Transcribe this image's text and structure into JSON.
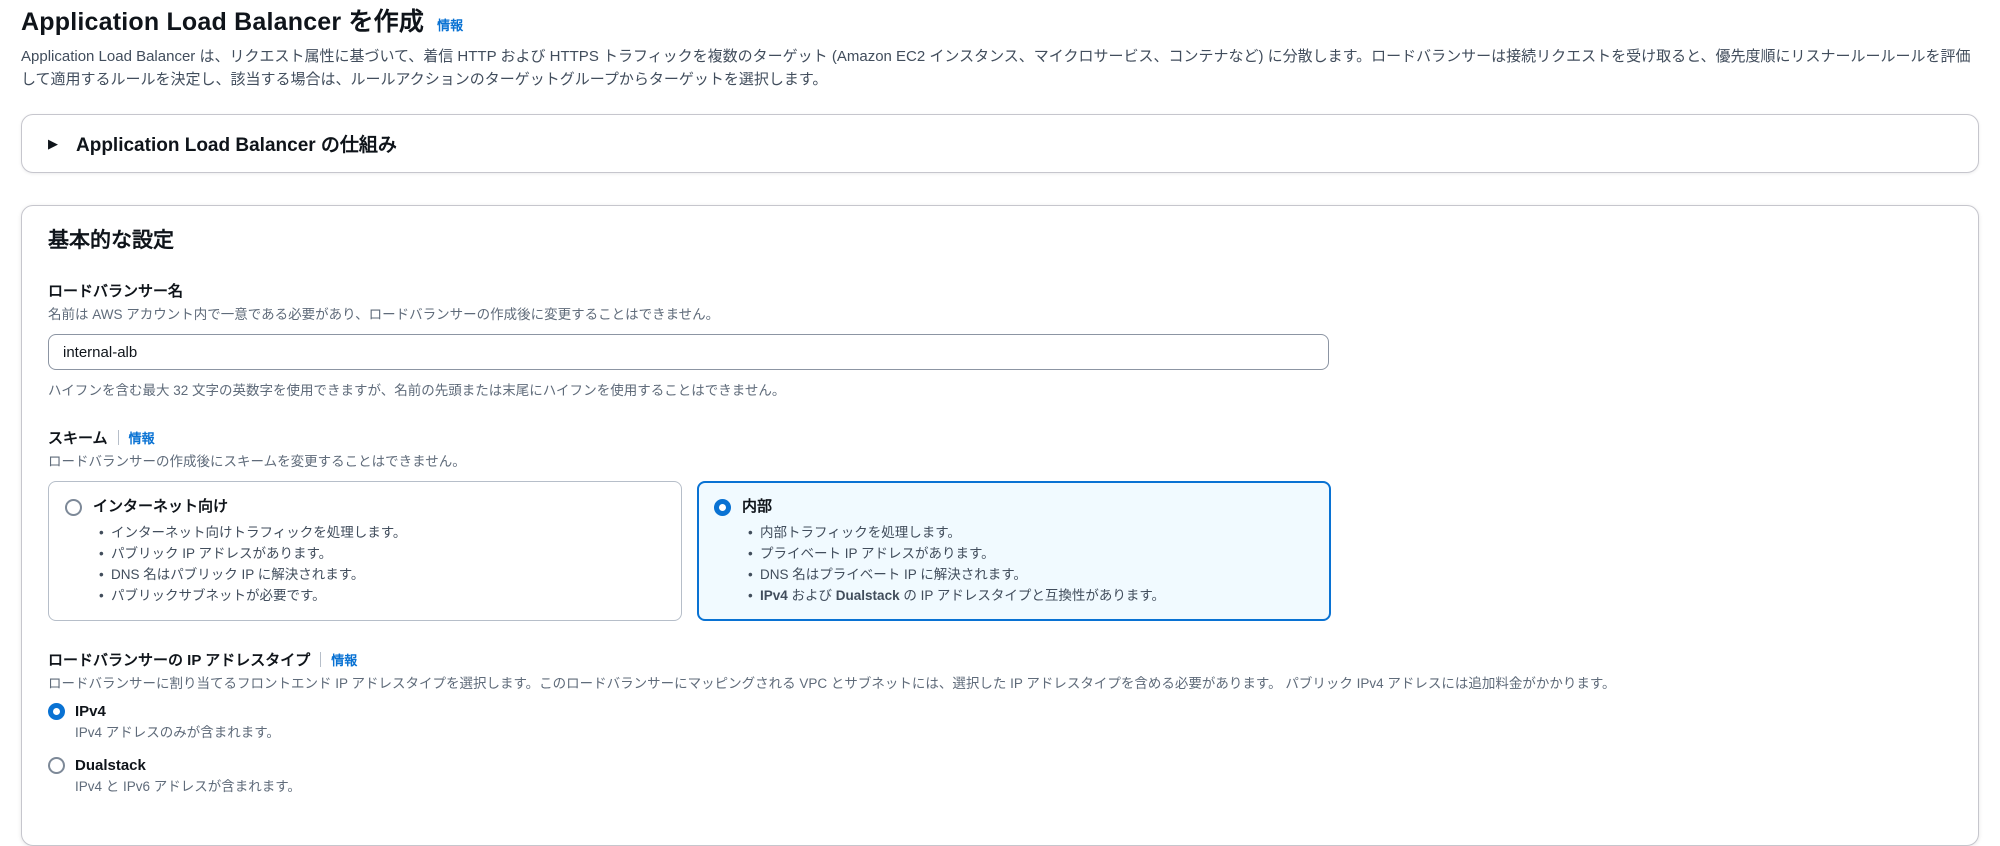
{
  "page": {
    "title": "Application Load Balancer を作成",
    "title_info": "情報",
    "description": "Application Load Balancer は、リクエスト属性に基づいて、着信 HTTP および HTTPS トラフィックを複数のターゲット (Amazon EC2 インスタンス、マイクロサービス、コンテナなど) に分散します。ロードバランサーは接続リクエストを受け取ると、優先度順にリスナールールールを評価して適用するルールを決定し、該当する場合は、ルールアクションのターゲットグループからターゲットを選択します。"
  },
  "how_it_works": {
    "label": "Application Load Balancer の仕組み",
    "caret": "▶"
  },
  "basic_config": {
    "heading": "基本的な設定",
    "name": {
      "label": "ロードバランサー名",
      "description": "名前は AWS アカウント内で一意である必要があり、ロードバランサーの作成後に変更することはできません。",
      "value": "internal-alb",
      "constraint": "ハイフンを含む最大 32 文字の英数字を使用できますが、名前の先頭または末尾にハイフンを使用することはできません。"
    },
    "scheme": {
      "label": "スキーム",
      "info": "情報",
      "description": "ロードバランサーの作成後にスキームを変更することはできません。",
      "internet_facing": {
        "label": "インターネット向け",
        "bullets": [
          "インターネット向けトラフィックを処理します。",
          "パブリック IP アドレスがあります。",
          "DNS 名はパブリック IP に解決されます。",
          "パブリックサブネットが必要です。"
        ]
      },
      "internal": {
        "label": "内部",
        "bullets": [
          "内部トラフィックを処理します。",
          "プライベート IP アドレスがあります。",
          "DNS 名はプライベート IP に解決されます。"
        ],
        "bullet4": {
          "b1": "IPv4",
          "t1": " および ",
          "b2": "Dualstack",
          "t2": " の IP アドレスタイプと互換性があります。"
        }
      }
    },
    "ip_type": {
      "label": "ロードバランサーの IP アドレスタイプ",
      "info": "情報",
      "description": "ロードバランサーに割り当てるフロントエンド IP アドレスタイプを選択します。このロードバランサーにマッピングされる VPC とサブネットには、選択した IP アドレスタイプを含める必要があります。 パブリック IPv4 アドレスには追加料金がかかります。",
      "ipv4": {
        "label": "IPv4",
        "description": "IPv4 アドレスのみが含まれます。"
      },
      "dualstack": {
        "label": "Dualstack",
        "description": "IPv4 と IPv6 アドレスが含まれます。"
      }
    }
  },
  "colors": {
    "link_blue": "#0972d3",
    "selected_border": "#0972d3",
    "selected_bg": "#f1faff",
    "text_primary": "#0f141a",
    "text_secondary": "#5f6b7a"
  }
}
